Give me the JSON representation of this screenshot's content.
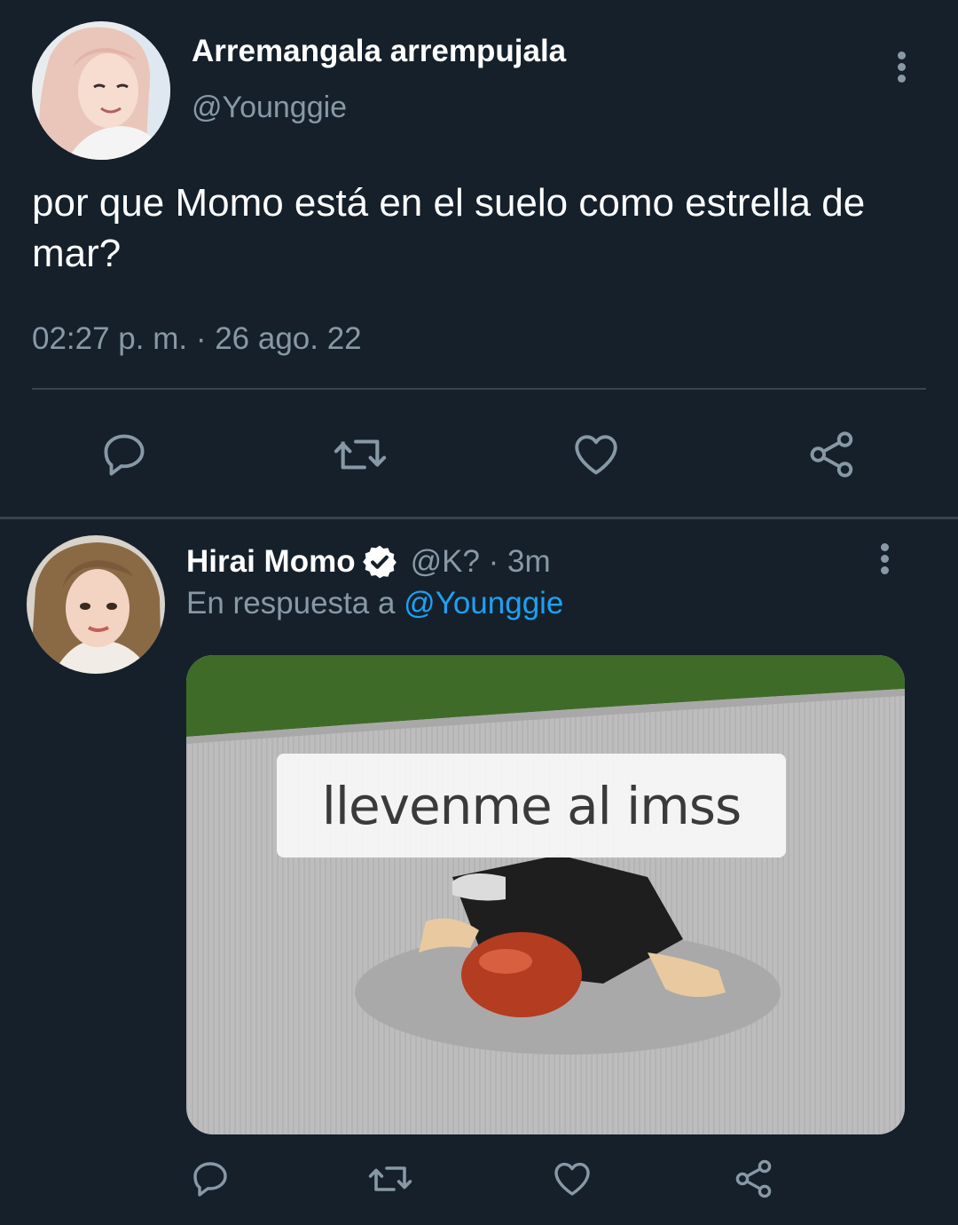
{
  "tweet": {
    "author_name": "Arremangala arrempujala",
    "author_handle": "@Younggie",
    "text": "por que Momo está en el suelo como estrella de mar?",
    "timestamp": "02:27 p. m. · 26 ago. 22",
    "avatar_icon": "avatar-photo",
    "menu_icon": "more-vertical-icon"
  },
  "actions": [
    {
      "name": "reply",
      "icon": "reply-icon"
    },
    {
      "name": "retweet",
      "icon": "retweet-icon"
    },
    {
      "name": "like",
      "icon": "heart-icon"
    },
    {
      "name": "share",
      "icon": "share-icon"
    }
  ],
  "reply": {
    "author_name": "Hirai Momo",
    "verified": true,
    "author_handle": "@K?",
    "separator": "·",
    "time_ago": "3m",
    "reply_prefix": "En respuesta a",
    "reply_to": "@Younggie",
    "media_caption": "llevenme al imss"
  },
  "colors": {
    "background": "#15202b",
    "divider": "#38444d",
    "secondary_text": "#8899a6",
    "link": "#1da1f2",
    "primary_text": "#ffffff"
  }
}
